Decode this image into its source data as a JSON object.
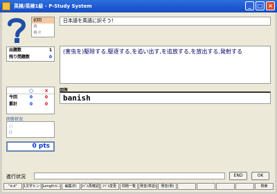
{
  "window": {
    "title": "英検/英検1級 - P-Study System"
  },
  "conditions": [
    "初回",
    "再",
    "再々"
  ],
  "stats": [
    {
      "label": "出題数",
      "value": "1"
    },
    {
      "label": "残り問題数",
      "value": "0"
    }
  ],
  "score": {
    "correct_symbol": "○",
    "wrong_symbol": "×",
    "rows": [
      {
        "label": "今回",
        "correct": "0",
        "wrong": "0"
      },
      {
        "label": "累計",
        "correct": "0",
        "wrong": "0"
      }
    ]
  },
  "answer_status": {
    "label": "回答状況",
    "lines": [
      "○",
      "()"
    ]
  },
  "points": "0 pts",
  "instruction": "日本語を英語に訳そう！",
  "question": "(害虫を)駆除する,駆逐する,を追い出す,を追放する,を放出する,発射する",
  "answer": {
    "label": "回答",
    "value": "banish"
  },
  "progress": {
    "label": "進行状況",
    "value": 0
  },
  "buttons": {
    "end": "END",
    "ok": "OK"
  },
  "toolbar": [
    "\"d.d\"",
    "1文字ヒント",
    "Lengthヒント",
    "編集(E)",
    "ｽﾍﾟﾙ再確認",
    "ｽﾍﾟﾙ変更",
    "問題一覧",
    "発音(単語)",
    "発音(例)",
    "",
    "",
    "",
    "",
    "検索"
  ],
  "colors": {
    "title_bar": "#1f5bd2",
    "accent_blue": "#0033cc",
    "accent_red": "#cc0000",
    "selected_condition": "#f6c9a4"
  }
}
